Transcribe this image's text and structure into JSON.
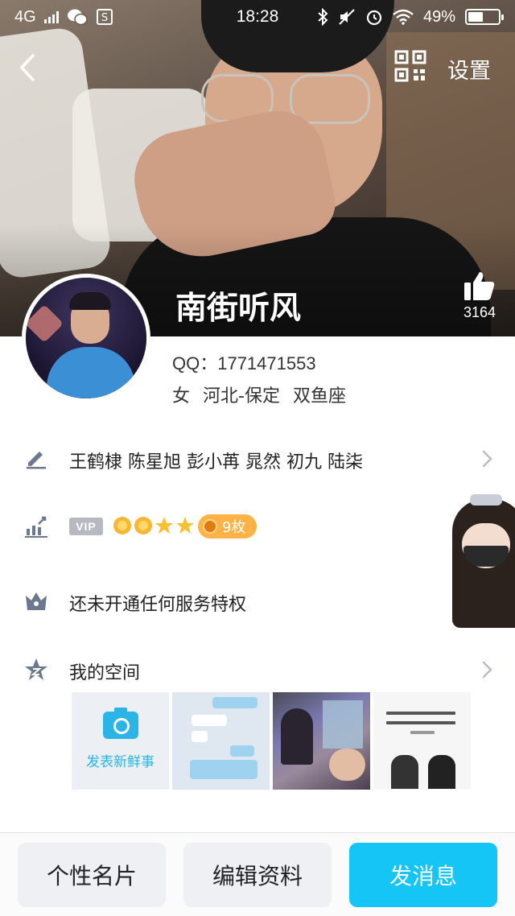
{
  "status_bar": {
    "network": "4G",
    "time": "18:28",
    "battery": "49%",
    "battery_level": 0.49
  },
  "header": {
    "settings_label": "设置",
    "back_icon": "chevron-left-icon",
    "qr_icon": "qr-code-icon"
  },
  "profile": {
    "nickname": "南街听风",
    "like_count": "3164",
    "qq": "QQ：1771471553",
    "gender": "女",
    "location": "河北-保定",
    "constellation": "双鱼座"
  },
  "rows": {
    "signature": "王鹤棣 陈星旭 彭小苒  晁然 初九 陆柒",
    "vip_label": "VIP",
    "medal_count": "9枚",
    "service": "还未开通任何服务特权",
    "space": "我的空间"
  },
  "space": {
    "new_post_label": "发表新鲜事"
  },
  "bottom": {
    "card_label": "个性名片",
    "edit_label": "编辑资料",
    "message_label": "发消息"
  },
  "colors": {
    "accent_blue": "#14c5f5",
    "camera_blue": "#2bb5e6",
    "medal_orange": "#ffb347",
    "icon_gray": "#6b7890"
  }
}
